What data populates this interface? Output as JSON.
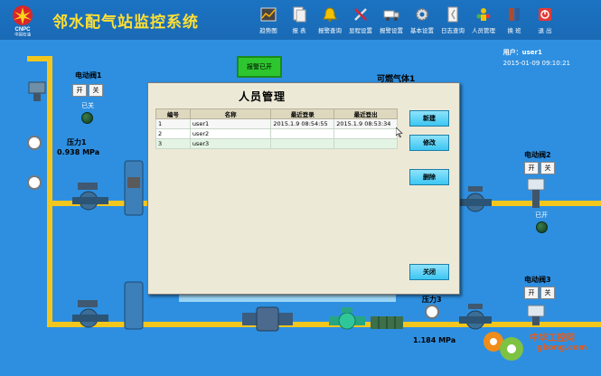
{
  "header": {
    "title": "邻水配气站监控系统",
    "logo_text": "CNPC",
    "logo_sub": "中国石油",
    "toolbar": [
      {
        "label": "趋势图",
        "icon": "trend-chart-icon"
      },
      {
        "label": "报 表",
        "icon": "report-icon"
      },
      {
        "label": "报警查询",
        "icon": "alarm-bell-icon"
      },
      {
        "label": "显程设置",
        "icon": "tools-icon"
      },
      {
        "label": "报警设置",
        "icon": "truck-icon"
      },
      {
        "label": "基本设置",
        "icon": "gear-icon"
      },
      {
        "label": "日志查询",
        "icon": "log-icon"
      },
      {
        "label": "人员管理",
        "icon": "users-icon"
      },
      {
        "label": "换 班",
        "icon": "door-icon"
      },
      {
        "label": "退 出",
        "icon": "exit-icon"
      }
    ]
  },
  "status": {
    "user_label": "用户：",
    "user": "user1",
    "datetime": "2015-01-09 09:10:21"
  },
  "scada": {
    "valve1_label": "电动阀1",
    "valve1_state": "已关",
    "valve2_label": "电动阀2",
    "valve2_state": "已开",
    "valve3_label": "电动阀3",
    "open_label": "开",
    "close_label": "关",
    "pressure1_label": "压力1",
    "pressure1_value": "0.938 MPa",
    "pressure3_label": "压力3",
    "pressure3_value": "1.184 MPa",
    "alarm_button": "报警已开",
    "gas_label": "可燃气体1"
  },
  "dialog": {
    "title": "人员管理",
    "columns": [
      "编号",
      "名称",
      "最近登录",
      "最近登出"
    ],
    "rows": [
      [
        "1",
        "user1",
        "2015.1.9 08:54:55",
        "2015.1.9 08:53:34"
      ],
      [
        "2",
        "user2",
        "",
        ""
      ],
      [
        "3",
        "user3",
        "",
        ""
      ]
    ],
    "buttons": {
      "new": "新建",
      "edit": "修改",
      "delete": "删除",
      "close": "关闭"
    }
  },
  "watermark": {
    "text": "中华工控网",
    "url": "gkong.com"
  },
  "colors": {
    "title": "#ffe033",
    "background": "#2e8fe0",
    "pipe": "#f3c61e",
    "dialog_button": "#3cc6f2",
    "alarm": "#2ec62e"
  }
}
